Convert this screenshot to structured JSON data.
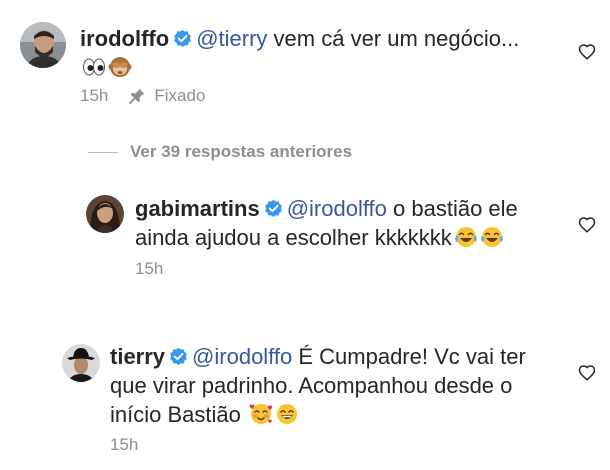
{
  "comments": [
    {
      "username": "irodolffo",
      "mention": "@tierry",
      "text": " vem cá ver um negócio...",
      "time": "15h",
      "pinned_label": "Fixado"
    },
    {
      "username": "gabimartins",
      "mention": "@irodolffo",
      "text_line1": " o bastião ele",
      "text_line2": "ainda ajudou a escolher kkkkkkk",
      "time": "15h"
    },
    {
      "username": "tierry",
      "mention": "@irodolffo",
      "text_line1": " É Cumpadre! Vc vai ter",
      "text_line2": "que virar padrinho. Acompanhou desde o",
      "text_line3": "início Bastião",
      "time": "15h"
    }
  ],
  "view_replies": "Ver 39 respostas anteriores",
  "icons": {
    "verified": "verified-badge-icon",
    "heart": "heart-outline-icon",
    "pin": "pin-icon"
  },
  "colors": {
    "verified": "#3897f0",
    "mention": "#385898",
    "meta": "#8e8e8e"
  }
}
